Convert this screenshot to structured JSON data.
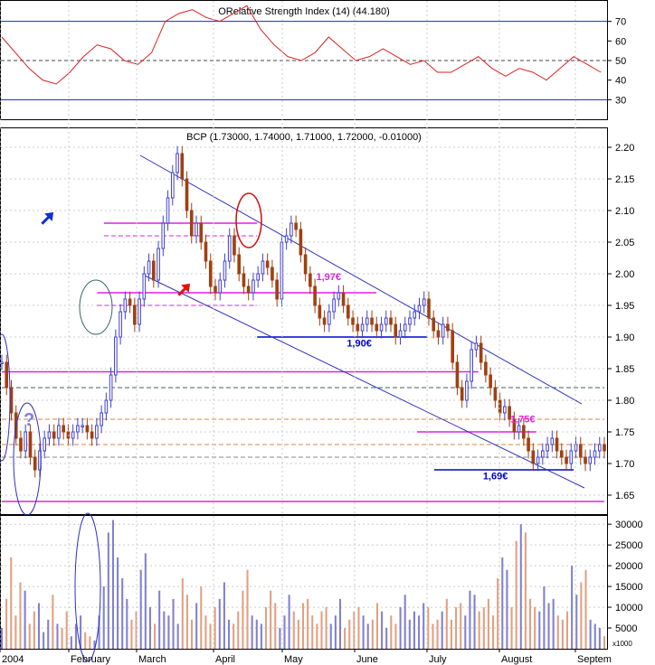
{
  "chart_data": [
    {
      "type": "line",
      "panel": "oscillator",
      "title": "ORelative Strength Index (14) (44.180)",
      "ylim": [
        20,
        80
      ],
      "yticks": [
        30,
        40,
        50,
        60,
        70
      ],
      "reference_lines": [
        {
          "value": 70,
          "color": "#1a1aff",
          "style": "solid"
        },
        {
          "value": 50,
          "color": "#444444",
          "style": "dashed"
        },
        {
          "value": 30,
          "color": "#1a1aff",
          "style": "solid"
        }
      ],
      "series": [
        {
          "color": "#e02020",
          "x_index": [
            0,
            4,
            8,
            12,
            16,
            20,
            24,
            28,
            32,
            36,
            40,
            44,
            48,
            52,
            56,
            60,
            64,
            68,
            72,
            76,
            80,
            84,
            88,
            92,
            96,
            100,
            104,
            108,
            112,
            116,
            120,
            124,
            128,
            132,
            136,
            140,
            144,
            148,
            152,
            156,
            160,
            164,
            168,
            172,
            176
          ],
          "values": [
            62,
            54,
            46,
            40,
            38,
            44,
            52,
            58,
            56,
            50,
            48,
            54,
            70,
            74,
            76,
            72,
            70,
            74,
            78,
            66,
            58,
            52,
            50,
            54,
            62,
            56,
            50,
            52,
            56,
            52,
            48,
            50,
            44,
            44,
            48,
            52,
            46,
            42,
            46,
            44,
            40,
            46,
            52,
            48,
            44
          ]
        }
      ]
    },
    {
      "type": "candlestick",
      "panel": "price",
      "title": "BCP (1.73000, 1.74000, 1.71000, 1.72000, -0.01000)",
      "ylim": [
        1.62,
        2.23
      ],
      "yticks": [
        1.65,
        1.7,
        1.75,
        1.8,
        1.85,
        1.9,
        1.95,
        2.0,
        2.05,
        2.1,
        2.15,
        2.2
      ],
      "ytick_labels": [
        "1.65",
        "1.70",
        "1.75",
        "1.80",
        "1.85",
        "1.90",
        "1.95",
        "2.00",
        "2.05",
        "2.10",
        "2.15",
        "2.20"
      ],
      "up_color": "#4040d0",
      "down_color": "#a04010",
      "series": [
        {
          "name": "BCP",
          "close": [
            1.86,
            1.82,
            1.78,
            1.74,
            1.72,
            1.75,
            1.71,
            1.69,
            1.72,
            1.74,
            1.75,
            1.74,
            1.76,
            1.75,
            1.74,
            1.75,
            1.76,
            1.76,
            1.75,
            1.74,
            1.76,
            1.78,
            1.8,
            1.84,
            1.9,
            1.94,
            1.96,
            1.95,
            1.92,
            1.96,
            2.0,
            2.02,
            1.99,
            2.04,
            2.08,
            2.12,
            2.16,
            2.19,
            2.15,
            2.1,
            2.06,
            2.08,
            2.05,
            2.02,
            1.98,
            1.97,
            1.99,
            2.02,
            2.06,
            2.03,
            2.0,
            1.98,
            1.97,
            1.99,
            2.0,
            2.02,
            2.01,
            1.99,
            1.96,
            2.05,
            2.06,
            2.08,
            2.07,
            2.03,
            2.0,
            1.98,
            1.95,
            1.93,
            1.92,
            1.94,
            1.96,
            1.97,
            1.95,
            1.93,
            1.92,
            1.91,
            1.92,
            1.93,
            1.92,
            1.91,
            1.92,
            1.93,
            1.92,
            1.9,
            1.91,
            1.92,
            1.93,
            1.94,
            1.95,
            1.96,
            1.93,
            1.91,
            1.9,
            1.92,
            1.91,
            1.86,
            1.82,
            1.8,
            1.83,
            1.88,
            1.89,
            1.86,
            1.84,
            1.82,
            1.8,
            1.78,
            1.79,
            1.77,
            1.75,
            1.76,
            1.74,
            1.72,
            1.7,
            1.71,
            1.72,
            1.73,
            1.74,
            1.72,
            1.71,
            1.7,
            1.72,
            1.73,
            1.71,
            1.7,
            1.71,
            1.72,
            1.73,
            1.72
          ],
          "note": "approximate daily closes read from the price panel"
        }
      ],
      "reference_lines": [
        {
          "value": 2.08,
          "color": "#e020e0",
          "style": "solid",
          "from_index": 30,
          "to_index": 75
        },
        {
          "value": 2.06,
          "color": "#e020e0",
          "style": "dashed",
          "from_index": 30,
          "to_index": 75
        },
        {
          "value": 1.97,
          "color": "#e020e0",
          "style": "solid",
          "from_index": 28,
          "to_index": 110
        },
        {
          "value": 1.95,
          "color": "#e020e0",
          "style": "dashed",
          "from_index": 28,
          "to_index": 75
        },
        {
          "value": 1.9,
          "color": "#0000cc",
          "style": "solid",
          "from_index": 75,
          "to_index": 125
        },
        {
          "value": 1.845,
          "color": "#e020e0",
          "style": "solid",
          "from_index": 0,
          "to_index": 140
        },
        {
          "value": 1.82,
          "color": "#336666",
          "style": "dashed",
          "from_index": 0,
          "to_index": 177
        },
        {
          "value": 1.77,
          "color": "#e08040",
          "style": "dashed",
          "from_index": 0,
          "to_index": 177
        },
        {
          "value": 1.75,
          "color": "#e020e0",
          "style": "solid",
          "from_index": 122,
          "to_index": 157
        },
        {
          "value": 1.73,
          "color": "#e08040",
          "style": "dashed",
          "from_index": 0,
          "to_index": 177
        },
        {
          "value": 1.71,
          "color": "#888888",
          "style": "dashed",
          "from_index": 0,
          "to_index": 177
        },
        {
          "value": 1.69,
          "color": "#0000cc",
          "style": "solid",
          "from_index": 127,
          "to_index": 168
        },
        {
          "value": 1.64,
          "color": "#e020e0",
          "style": "solid",
          "from_index": 0,
          "to_index": 177
        }
      ],
      "annotations": [
        {
          "text": "1,97€",
          "color": "#e020e0",
          "x_index": 96,
          "value": 1.99
        },
        {
          "text": "1,90€",
          "color": "#0000cc",
          "x_index": 105,
          "value": 1.885
        },
        {
          "text": "1,75€",
          "color": "#e020e0",
          "x_index": 153,
          "value": 1.765
        },
        {
          "text": "1,69€",
          "color": "#0000cc",
          "x_index": 145,
          "value": 1.675
        },
        {
          "text": "?",
          "color": "#8080e0",
          "x_index": 8,
          "value": 1.76
        }
      ]
    },
    {
      "type": "bar",
      "panel": "volume",
      "ylim": [
        0,
        32000
      ],
      "yticks": [
        5000,
        10000,
        15000,
        20000,
        25000,
        30000
      ],
      "ytick_labels": [
        "5000",
        "10000",
        "15000",
        "20000",
        "25000",
        "30000"
      ],
      "unit_label": "x1000",
      "values": [
        5000,
        12000,
        22000,
        8000,
        16000,
        14000,
        6000,
        9000,
        11000,
        4000,
        7000,
        13000,
        6000,
        5000,
        9000,
        3000,
        6000,
        8000,
        4000,
        3000,
        2000,
        8000,
        15000,
        28000,
        31000,
        22000,
        17000,
        12000,
        7000,
        9000,
        19000,
        23000,
        10000,
        6000,
        14000,
        9000,
        8000,
        12000,
        6000,
        17000,
        13000,
        7000,
        11000,
        15000,
        8000,
        6000,
        10000,
        12000,
        16000,
        7000,
        6000,
        9000,
        14000,
        19000,
        8000,
        7000,
        6000,
        10000,
        14000,
        11000,
        5000,
        8000,
        13000,
        9000,
        7000,
        11000,
        12000,
        8000,
        6000,
        9000,
        10000,
        6000,
        8000,
        12000,
        5000,
        7000,
        9000,
        10000,
        8000,
        6000,
        7000,
        11000,
        9000,
        5000,
        8000,
        6000,
        10000,
        13000,
        7000,
        9000,
        8000,
        11000,
        10000,
        6000,
        7000,
        9000,
        12000,
        7000,
        10000,
        11000,
        8000,
        14000,
        13000,
        9000,
        10000,
        12000,
        8000,
        17000,
        22000,
        19000,
        10000,
        26000,
        30000,
        28000,
        12000,
        10000,
        9000,
        15000,
        11000,
        12000,
        8000,
        7000,
        9000,
        20000,
        13000,
        16000,
        19000,
        7000,
        6000,
        5000,
        3000
      ]
    }
  ],
  "x_axis": {
    "labels": [
      "2004",
      "February",
      "March",
      "April",
      "May",
      "June",
      "July",
      "August",
      "Septem"
    ]
  }
}
